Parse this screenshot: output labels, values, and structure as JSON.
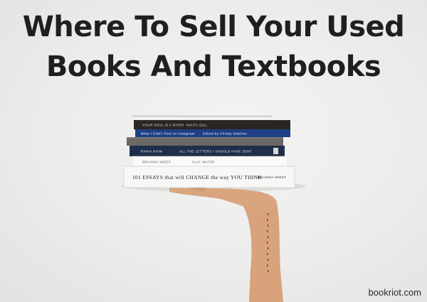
{
  "headline": {
    "line1": "Where To Sell Your Used",
    "line2": "Books And Textbooks"
  },
  "credit": "bookriot.com",
  "books": [
    {
      "spine_left": "",
      "spine_right": ""
    },
    {
      "spine_left": "YOUR SOUL IS A RIVER",
      "spine_right": "NIKITA GILL"
    },
    {
      "spine_left": "What I Didn't Post on Instagram",
      "spine_right": "Edited by Christy Steelton"
    },
    {
      "spine_left": "",
      "spine_right": ""
    },
    {
      "spine_left": "RANIA NAIM",
      "spine_right": "ALL THE LETTERS I SHOULD HAVE SENT"
    },
    {
      "spine_left": "BRIANNA WIEST",
      "spine_right": "SALT WATER"
    },
    {
      "spine_left": "101 ESSAYS that will CHANGE the way YOU THINK",
      "spine_right": "BRIANNA WIEST"
    }
  ],
  "colors": {
    "background": "#ececeb",
    "headline": "#1f1f1f",
    "book_blue": "#1d3f86",
    "book_navy": "#1f2e4a",
    "book_dark": "#2a2623",
    "skin": "#d9a57f"
  }
}
